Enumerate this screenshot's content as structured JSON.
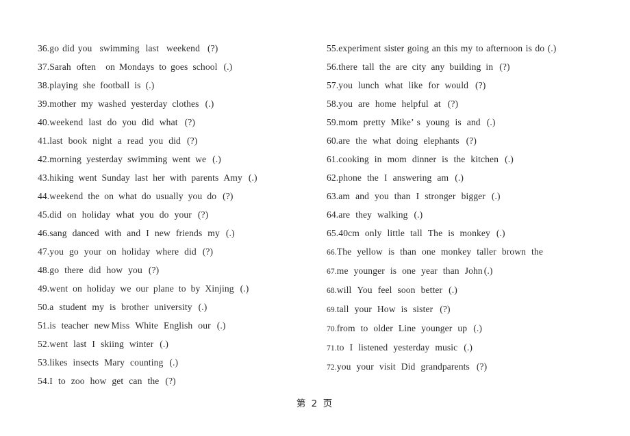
{
  "document": {
    "page_footer": "第 2 页",
    "page_number": "2"
  },
  "left_column": {
    "items": [
      {
        "number": "36.",
        "text": "go did you swimming last weekend (?)",
        "spacing": [
          5,
          5,
          11,
          9,
          11,
          11
        ],
        "wide": false,
        "small_num": false
      },
      {
        "number": "37.",
        "text": "Sarah often on Mondays to goes school (.)",
        "spacing": [
          8,
          14,
          6,
          7,
          6,
          7,
          9
        ],
        "wide": false,
        "small_num": false
      },
      {
        "number": "38.",
        "text": "playing she football is (.)",
        "spacing": [
          7,
          7,
          7,
          7
        ],
        "wide": false,
        "small_num": false
      },
      {
        "number": "39.",
        "text": "mother my washed yesterday clothes (.)",
        "spacing": [
          7,
          7,
          7,
          7,
          9
        ],
        "wide": false,
        "small_num": false
      },
      {
        "number": "40.",
        "text": "weekend last do you did what (?)",
        "spacing": [
          8,
          8,
          8,
          8,
          8,
          10
        ],
        "wide": false,
        "small_num": false
      },
      {
        "number": "41.",
        "text": "last book night a read you did (?)",
        "spacing": [
          8,
          8,
          8,
          8,
          8,
          8,
          9
        ],
        "wide": false,
        "small_num": false
      },
      {
        "number": "42.",
        "text": "morning yesterday swimming went we (.)",
        "spacing": [
          7,
          7,
          7,
          7,
          9
        ],
        "wide": false,
        "small_num": false
      },
      {
        "number": "43.",
        "text": "hiking went Sunday last her with parents Amy (.)",
        "spacing": [
          7,
          7,
          7,
          7,
          7,
          7,
          7,
          9
        ],
        "wide": false,
        "small_num": false
      },
      {
        "number": "44.",
        "text": "weekend the on what do usually you do (?)",
        "spacing": [
          7,
          7,
          7,
          7,
          7,
          7,
          7,
          9
        ],
        "wide": false,
        "small_num": false
      },
      {
        "number": "45.",
        "text": "did on holiday what you do your (?)",
        "spacing": [
          8,
          8,
          8,
          8,
          8,
          8,
          9
        ],
        "wide": false,
        "small_num": false
      },
      {
        "number": "46.",
        "text": "sang danced with and I new friends my (.)",
        "spacing": [
          8,
          8,
          8,
          8,
          8,
          8,
          8,
          9
        ],
        "wide": false,
        "small_num": false
      },
      {
        "number": "47.",
        "text": "you go your on holiday where did (?)",
        "spacing": [
          8,
          8,
          8,
          8,
          8,
          8,
          9
        ],
        "wide": false,
        "small_num": false
      },
      {
        "number": "48.",
        "text": "go there did how you (?)",
        "spacing": [
          8,
          8,
          8,
          8,
          9
        ],
        "wide": false,
        "small_num": false
      },
      {
        "number": "49.",
        "text": "went on holiday we our plane to by Xinjing (.)",
        "spacing": [
          7,
          7,
          7,
          7,
          7,
          7,
          7,
          7,
          9
        ],
        "wide": false,
        "small_num": false
      },
      {
        "number": "50.",
        "text": "a student my is brother university (.)",
        "spacing": [
          8,
          8,
          8,
          8,
          8,
          9
        ],
        "wide": false,
        "small_num": false
      },
      {
        "number": "51.",
        "text": "is teacher new Miss White English our (.)",
        "spacing": [
          8,
          8,
          2,
          8,
          8,
          8,
          9
        ],
        "wide": false,
        "small_num": false
      },
      {
        "number": "52.",
        "text": "went last I skiing winter (.)",
        "spacing": [
          8,
          8,
          8,
          8,
          9
        ],
        "wide": false,
        "small_num": false
      },
      {
        "number": "53.",
        "text": "likes insects Mary counting (.)",
        "spacing": [
          8,
          8,
          8,
          9
        ],
        "wide": false,
        "small_num": false
      },
      {
        "number": "54.",
        "text": "I to zoo how get can the (?)",
        "spacing": [
          8,
          8,
          8,
          8,
          8,
          8,
          9
        ],
        "wide": false,
        "small_num": false
      }
    ]
  },
  "right_column": {
    "items": [
      {
        "number": "55.",
        "text": "experiment sister going an this my to afternoon is do (.)",
        "spacing": [],
        "wide": true,
        "small_num": false
      },
      {
        "number": "56.",
        "text": "there tall the are city any building in (?)",
        "spacing": [
          7,
          7,
          7,
          7,
          7,
          7,
          7,
          9
        ],
        "wide": false,
        "small_num": false
      },
      {
        "number": "57.",
        "text": "you lunch what like for would (?)",
        "spacing": [
          8,
          8,
          8,
          8,
          8,
          10
        ],
        "wide": false,
        "small_num": false
      },
      {
        "number": "58.",
        "text": "you are home helpful at (?)",
        "spacing": [
          8,
          8,
          8,
          8,
          10
        ],
        "wide": false,
        "small_num": false
      },
      {
        "number": "59.",
        "text": "mom pretty Mike’ s young is and (.)",
        "spacing": [
          8,
          8,
          4,
          8,
          8,
          8,
          9
        ],
        "wide": false,
        "small_num": false
      },
      {
        "number": "60.",
        "text": "are the what doing elephants (?)",
        "spacing": [
          8,
          8,
          8,
          8,
          10
        ],
        "wide": false,
        "small_num": false
      },
      {
        "number": "61.",
        "text": "cooking in mom dinner is the kitchen (.)",
        "spacing": [
          8,
          8,
          8,
          8,
          8,
          8,
          9
        ],
        "wide": false,
        "small_num": false
      },
      {
        "number": "62.",
        "text": "phone the I answering am (.)",
        "spacing": [
          8,
          8,
          8,
          8,
          9
        ],
        "wide": false,
        "small_num": false
      },
      {
        "number": "63.",
        "text": "am and you than I stronger bigger (.)",
        "spacing": [
          8,
          8,
          8,
          8,
          8,
          8,
          9
        ],
        "wide": false,
        "small_num": false
      },
      {
        "number": "64.",
        "text": "are they walking (.)",
        "spacing": [
          8,
          8,
          9
        ],
        "wide": false,
        "small_num": false
      },
      {
        "number": "65.",
        "text": "40cm only little tall The is monkey (.)",
        "spacing": [
          8,
          8,
          8,
          8,
          8,
          8,
          9
        ],
        "wide": false,
        "small_num": false
      },
      {
        "number": "66.",
        "text": "The yellow is than one monkey taller brown the",
        "spacing": [
          8,
          8,
          8,
          8,
          8,
          8,
          8,
          8
        ],
        "wide": false,
        "small_num": true
      },
      {
        "number": "67.",
        "text": "me younger is one year than John (.)",
        "spacing": [
          8,
          8,
          8,
          8,
          8,
          8,
          2
        ],
        "wide": false,
        "small_num": true
      },
      {
        "number": "68.",
        "text": "will You feel soon better (.)",
        "spacing": [
          8,
          8,
          8,
          8,
          9
        ],
        "wide": false,
        "small_num": true
      },
      {
        "number": "69.",
        "text": "tall your How is sister (?)",
        "spacing": [
          8,
          8,
          8,
          8,
          10
        ],
        "wide": false,
        "small_num": true
      },
      {
        "number": "70.",
        "text": "from to older Line younger up (.)",
        "spacing": [
          8,
          8,
          8,
          8,
          8,
          9
        ],
        "wide": false,
        "small_num": true
      },
      {
        "number": "71.",
        "text": "to I listened yesterday music (.)",
        "spacing": [
          8,
          8,
          8,
          8,
          9
        ],
        "wide": false,
        "small_num": true
      },
      {
        "number": "72.",
        "text": "you your visit Did grandparents (?)",
        "spacing": [
          8,
          8,
          8,
          8,
          10
        ],
        "wide": false,
        "small_num": true
      }
    ]
  }
}
